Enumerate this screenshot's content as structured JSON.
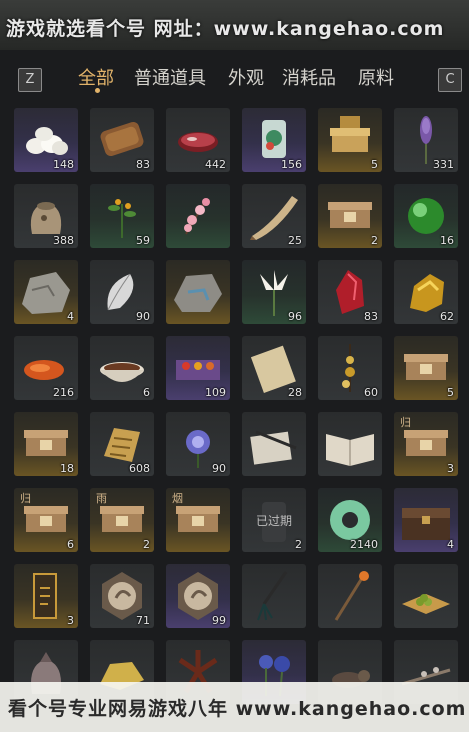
{
  "watermark_top": "游戏就选看个号  网址：www.kangehao.com",
  "watermark_bottom": "看个号专业网易游戏八年 www.kangehao.com",
  "keys": {
    "left": "Z",
    "right": "C"
  },
  "tabs": [
    {
      "label": "全部",
      "active": true
    },
    {
      "label": "普通道具",
      "active": false
    },
    {
      "label": "外观",
      "active": false
    },
    {
      "label": "消耗品",
      "active": false
    },
    {
      "label": "原料",
      "active": false
    }
  ],
  "items": [
    {
      "name": "steamed-buns",
      "count": "148",
      "tier": "purple",
      "icon": "buns"
    },
    {
      "name": "dried-meat",
      "count": "83",
      "tier": "gray",
      "icon": "jerky"
    },
    {
      "name": "raw-meat",
      "count": "442",
      "tier": "gray",
      "icon": "meat"
    },
    {
      "name": "jade-jar",
      "count": "156",
      "tier": "purple",
      "icon": "jar"
    },
    {
      "name": "gold-chest",
      "count": "5",
      "tier": "gold",
      "icon": "goldbox"
    },
    {
      "name": "lavender-flower",
      "count": "331",
      "tier": "gray",
      "icon": "lavender"
    },
    {
      "name": "rice-sack",
      "count": "388",
      "tier": "gray",
      "icon": "sack"
    },
    {
      "name": "herb-sprig",
      "count": "59",
      "tier": "green",
      "icon": "herb"
    },
    {
      "name": "pink-blossom",
      "count": "",
      "tier": "green",
      "icon": "blossom"
    },
    {
      "name": "horn",
      "count": "25",
      "tier": "gray",
      "icon": "horn"
    },
    {
      "name": "supply-box",
      "count": "2",
      "tier": "gold",
      "icon": "box"
    },
    {
      "name": "green-orb",
      "count": "16",
      "tier": "green",
      "icon": "orb"
    },
    {
      "name": "stone-ore",
      "count": "4",
      "tier": "gold",
      "icon": "stone"
    },
    {
      "name": "white-feather",
      "count": "90",
      "tier": "gray",
      "icon": "feather"
    },
    {
      "name": "mineral-ore",
      "count": "",
      "tier": "gold",
      "icon": "stone2"
    },
    {
      "name": "white-flower",
      "count": "96",
      "tier": "green",
      "icon": "flower"
    },
    {
      "name": "red-crystal",
      "count": "83",
      "tier": "gray",
      "icon": "redore"
    },
    {
      "name": "gold-nugget",
      "count": "62",
      "tier": "gray",
      "icon": "goldore"
    },
    {
      "name": "orange-fish",
      "count": "216",
      "tier": "gray",
      "icon": "fish"
    },
    {
      "name": "meat-bowl",
      "count": "6",
      "tier": "gray",
      "icon": "bowl"
    },
    {
      "name": "spice-box",
      "count": "109",
      "tier": "purple",
      "icon": "spicebox"
    },
    {
      "name": "paper-scroll",
      "count": "28",
      "tier": "gray",
      "icon": "scroll"
    },
    {
      "name": "beaded-charm",
      "count": "60",
      "tier": "gray",
      "icon": "charm"
    },
    {
      "name": "supply-box",
      "count": "5",
      "tier": "gold",
      "icon": "box"
    },
    {
      "name": "supply-box",
      "count": "18",
      "tier": "gold",
      "icon": "box"
    },
    {
      "name": "golden-tablet",
      "count": "608",
      "tier": "gray",
      "icon": "tablet"
    },
    {
      "name": "purple-chrysanthemum",
      "count": "90",
      "tier": "gray",
      "icon": "chrys"
    },
    {
      "name": "ink-brush-paper",
      "count": "",
      "tier": "gray",
      "icon": "brushpaper"
    },
    {
      "name": "open-book",
      "count": "",
      "tier": "gray",
      "icon": "book"
    },
    {
      "name": "return-box",
      "count": "3",
      "tier": "gold",
      "icon": "box",
      "tag": "归"
    },
    {
      "name": "return-box",
      "count": "6",
      "tier": "gold",
      "icon": "box",
      "tag": "归"
    },
    {
      "name": "rain-box",
      "count": "2",
      "tier": "gold",
      "icon": "box",
      "tag": "雨"
    },
    {
      "name": "smoke-box",
      "count": "",
      "tier": "gold",
      "icon": "box",
      "tag": "烟"
    },
    {
      "name": "expired-item",
      "count": "2",
      "tier": "gray",
      "icon": "expiredjar",
      "expired": "已过期"
    },
    {
      "name": "jade-ring",
      "count": "2140",
      "tier": "green",
      "icon": "ring"
    },
    {
      "name": "wooden-chest",
      "count": "4",
      "tier": "purple",
      "icon": "chest"
    },
    {
      "name": "gold-token",
      "count": "3",
      "tier": "gold",
      "icon": "token"
    },
    {
      "name": "bird-medal",
      "count": "71",
      "tier": "gray",
      "icon": "medal"
    },
    {
      "name": "bird-medal",
      "count": "99",
      "tier": "purple",
      "icon": "medal"
    },
    {
      "name": "hair-tassel",
      "count": "",
      "tier": "gray",
      "icon": "tassel"
    },
    {
      "name": "lantern-staff",
      "count": "",
      "tier": "gray",
      "icon": "staff"
    },
    {
      "name": "tea-tray",
      "count": "",
      "tier": "gray",
      "icon": "tray"
    },
    {
      "name": "pouch",
      "count": "",
      "tier": "gray",
      "icon": "pouch"
    },
    {
      "name": "gold-crumbs",
      "count": "",
      "tier": "gray",
      "icon": "crumbs"
    },
    {
      "name": "star-anise",
      "count": "",
      "tier": "gray",
      "icon": "anise"
    },
    {
      "name": "blue-flowers",
      "count": "",
      "tier": "purple",
      "icon": "blueflower"
    },
    {
      "name": "rat",
      "count": "",
      "tier": "gray",
      "icon": "rat"
    },
    {
      "name": "branch",
      "count": "",
      "tier": "gray",
      "icon": "branch"
    }
  ]
}
